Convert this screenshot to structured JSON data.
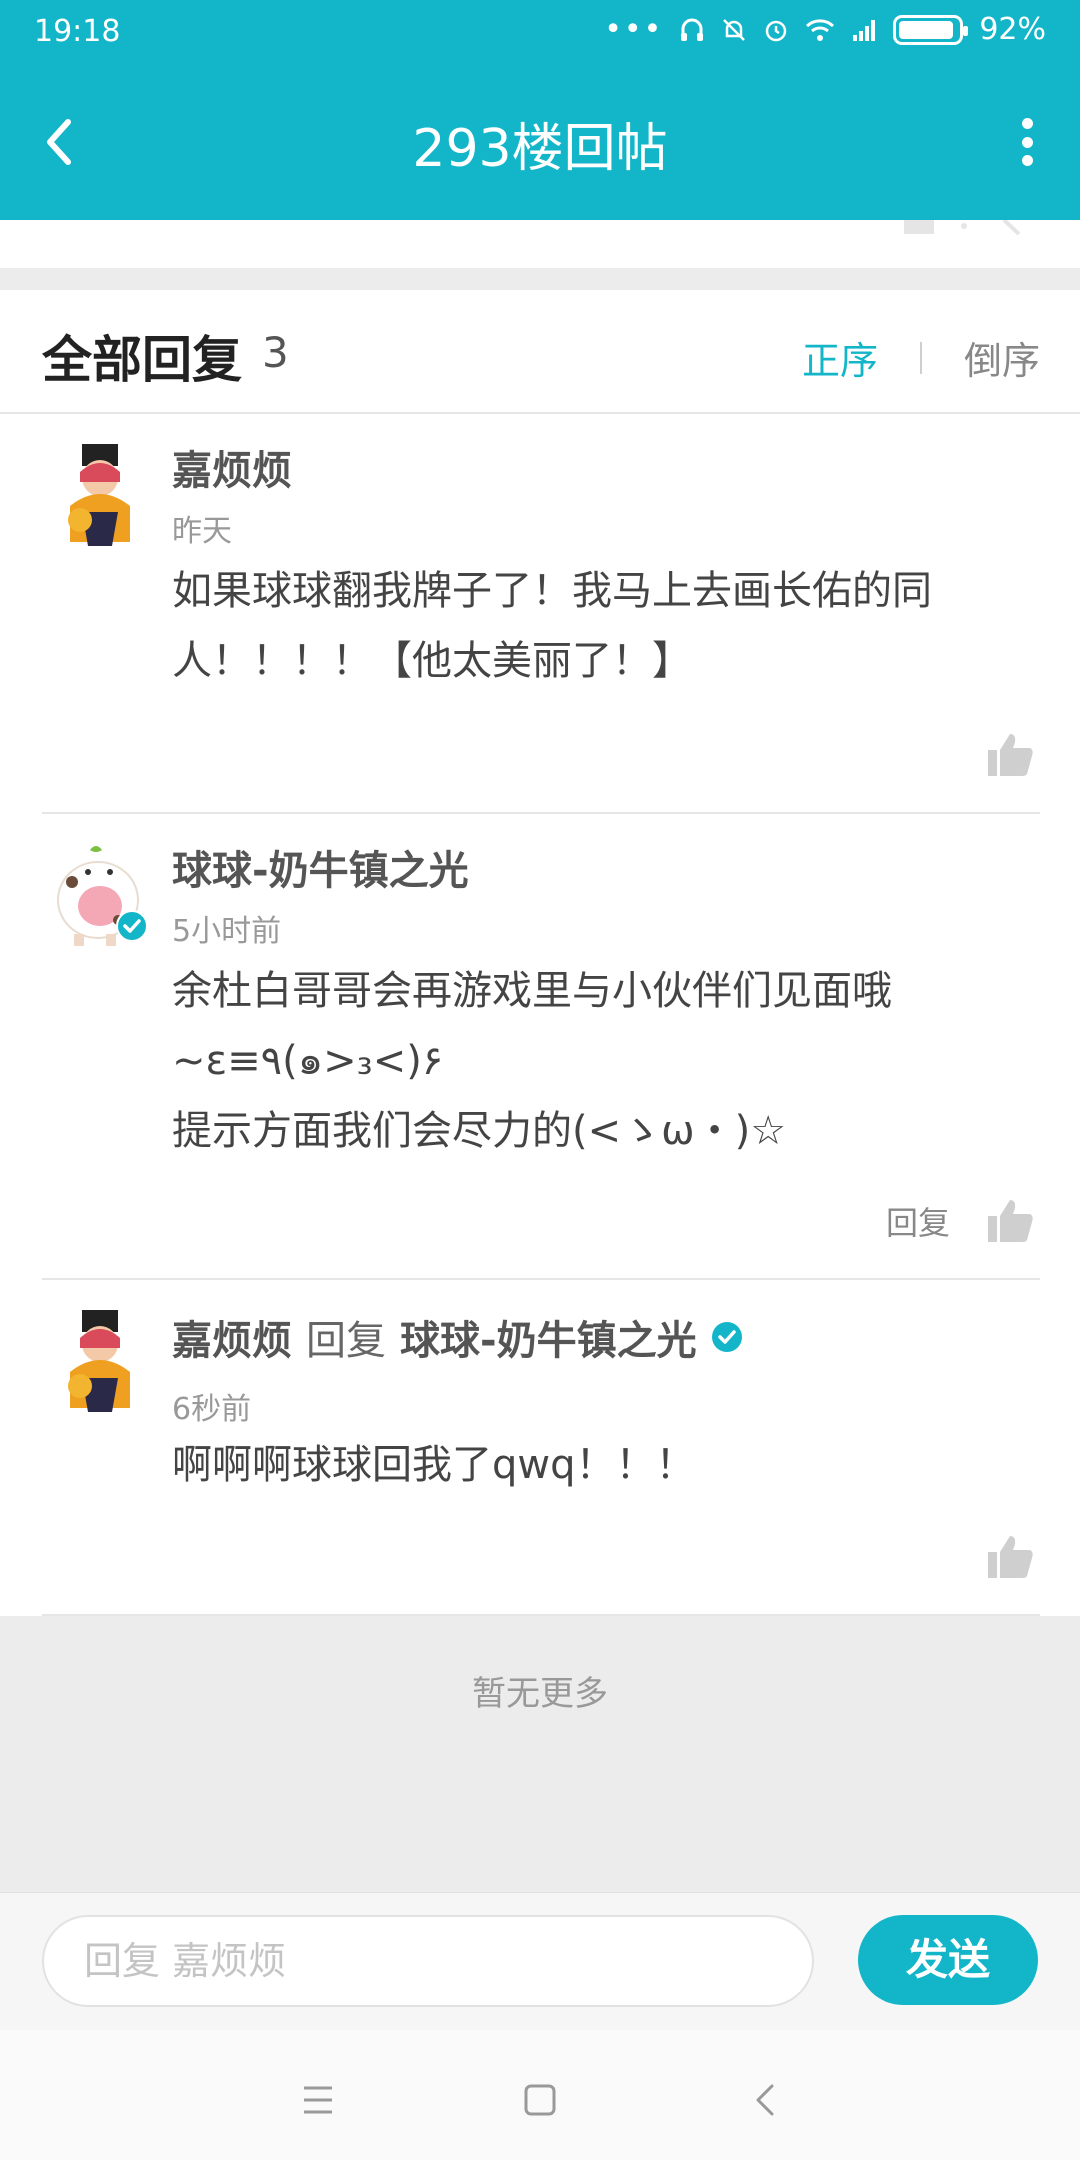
{
  "status_bar": {
    "time": "19:18",
    "battery_text": "92%",
    "battery_level": 0.92
  },
  "header": {
    "title": "293楼回帖"
  },
  "replies_header": {
    "label": "全部回复",
    "count": "3",
    "sort_asc": "正序",
    "sort_desc": "倒序"
  },
  "replies": [
    {
      "author": "嘉烦烦",
      "time": "昨天",
      "content": "如果球球翻我牌子了！我马上去画长佑的同人！！！！【他太美丽了！】"
    },
    {
      "author": "球球-奶牛镇之光",
      "time": "5小时前",
      "content_lines": [
        "余杜白哥哥会再游戏里与小伙伴们见面哦",
        "~ε≡٩(๑>₃<)۶",
        "提示方面我们会尽力的(<ゝω・)☆"
      ],
      "reply_label": "回复"
    },
    {
      "author": "嘉烦烦",
      "reply_word": "回复",
      "reply_to": "球球-奶牛镇之光",
      "time": "6秒前",
      "content": "啊啊啊球球回我了qwq！！！"
    }
  ],
  "no_more": "暂无更多",
  "input": {
    "placeholder": "回复 嘉烦烦",
    "send_label": "发送"
  },
  "colors": {
    "accent": "#13b6c8",
    "verified": "#13b6c8"
  }
}
